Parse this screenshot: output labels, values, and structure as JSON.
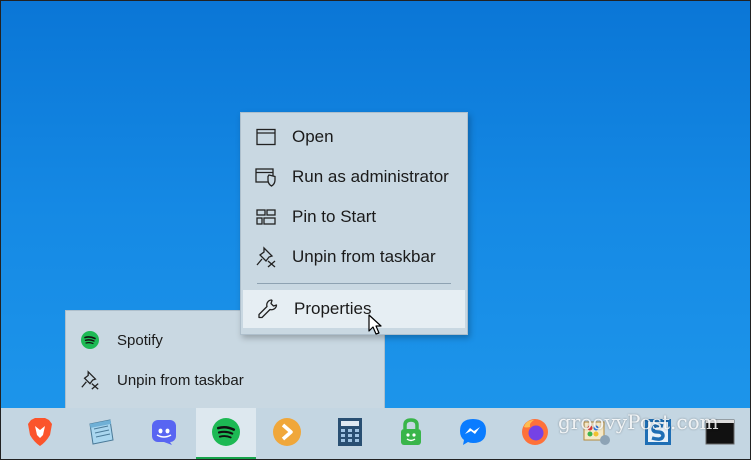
{
  "context_menu": {
    "items": [
      {
        "label": "Open",
        "icon": "window-icon"
      },
      {
        "label": "Run as administrator",
        "icon": "shield-icon"
      },
      {
        "label": "Pin to Start",
        "icon": "tiles-icon"
      },
      {
        "label": "Unpin from taskbar",
        "icon": "unpin-icon"
      },
      {
        "label": "Properties",
        "icon": "wrench-icon"
      }
    ],
    "highlighted": "Properties"
  },
  "jump_list": {
    "items": [
      {
        "label": "Spotify",
        "icon": "spotify-icon"
      },
      {
        "label": "Unpin from taskbar",
        "icon": "unpin-icon"
      }
    ]
  },
  "taskbar": {
    "apps": [
      {
        "name": "brave",
        "icon": "brave-icon",
        "color": "#fb542b"
      },
      {
        "name": "notepad",
        "icon": "notepad-icon",
        "color": "#8cc8e8"
      },
      {
        "name": "discord",
        "icon": "discord-icon",
        "color": "#5865f2"
      },
      {
        "name": "spotify",
        "icon": "spotify-icon",
        "color": "#1db954",
        "active": true
      },
      {
        "name": "plex",
        "icon": "plex-icon",
        "color": "#e5a00d"
      },
      {
        "name": "calculator",
        "icon": "calculator-icon",
        "color": "#1e4a6e"
      },
      {
        "name": "vpn",
        "icon": "lock-icon",
        "color": "#39b54a"
      },
      {
        "name": "messenger",
        "icon": "messenger-icon",
        "color": "#0a7cff"
      },
      {
        "name": "firefox",
        "icon": "firefox-icon",
        "color": "#ff7139"
      },
      {
        "name": "paint",
        "icon": "paint-icon",
        "color": "#e0a43a"
      },
      {
        "name": "snagit",
        "icon": "snagit-icon",
        "color": "#1f6fb5"
      },
      {
        "name": "terminal",
        "icon": "terminal-icon",
        "color": "#111111"
      }
    ]
  },
  "watermark": "groovyPost.com"
}
